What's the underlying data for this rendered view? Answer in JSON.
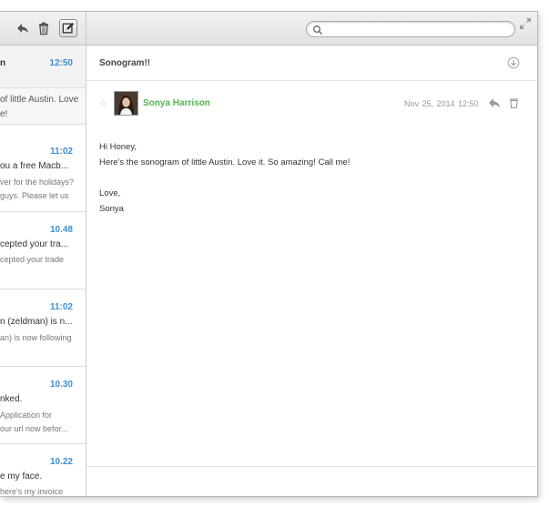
{
  "messages": [
    {
      "subject": "n",
      "time": "12:50",
      "preview_1": "of little Austin. Love",
      "preview_2": "e!"
    },
    {
      "subject": "ou a free Macb...",
      "time": "11:02",
      "preview_1": "ver for the holidays?",
      "preview_2": "guys. Please let us"
    },
    {
      "subject": "cepted your tra...",
      "time": "10.48",
      "preview_1": "cepted your trade",
      "preview_2": ""
    },
    {
      "subject": "n (zeldman) is n...",
      "time": "11:02",
      "preview_1": "an) is now following",
      "preview_2": ""
    },
    {
      "subject": "nked.",
      "time": "10.30",
      "preview_1": "Application for",
      "preview_2": "our url now befor..."
    },
    {
      "subject": "e my face.",
      "time": "10.22",
      "preview_1": "here's my invoice",
      "preview_2": ""
    }
  ],
  "toolbar": {
    "search_value": "",
    "icons": [
      "reply-icon",
      "trash-icon",
      "compose-icon",
      "search-icon",
      "expand-icon"
    ]
  },
  "reader": {
    "subject": "Sonogram!!",
    "sender": "Sonya Harrison",
    "date": "Nov 25, 2014  12:50",
    "body": {
      "greeting": "Hi Honey,",
      "line1": "Here's the sonogram of little Austin. Love it. So amazing! Call me!",
      "closing": "Love,",
      "signature": "Sonya"
    }
  },
  "colors": {
    "accent_time": "#3f8fd2",
    "sender": "#56b34f",
    "selected_row": "#f2f2f2"
  }
}
